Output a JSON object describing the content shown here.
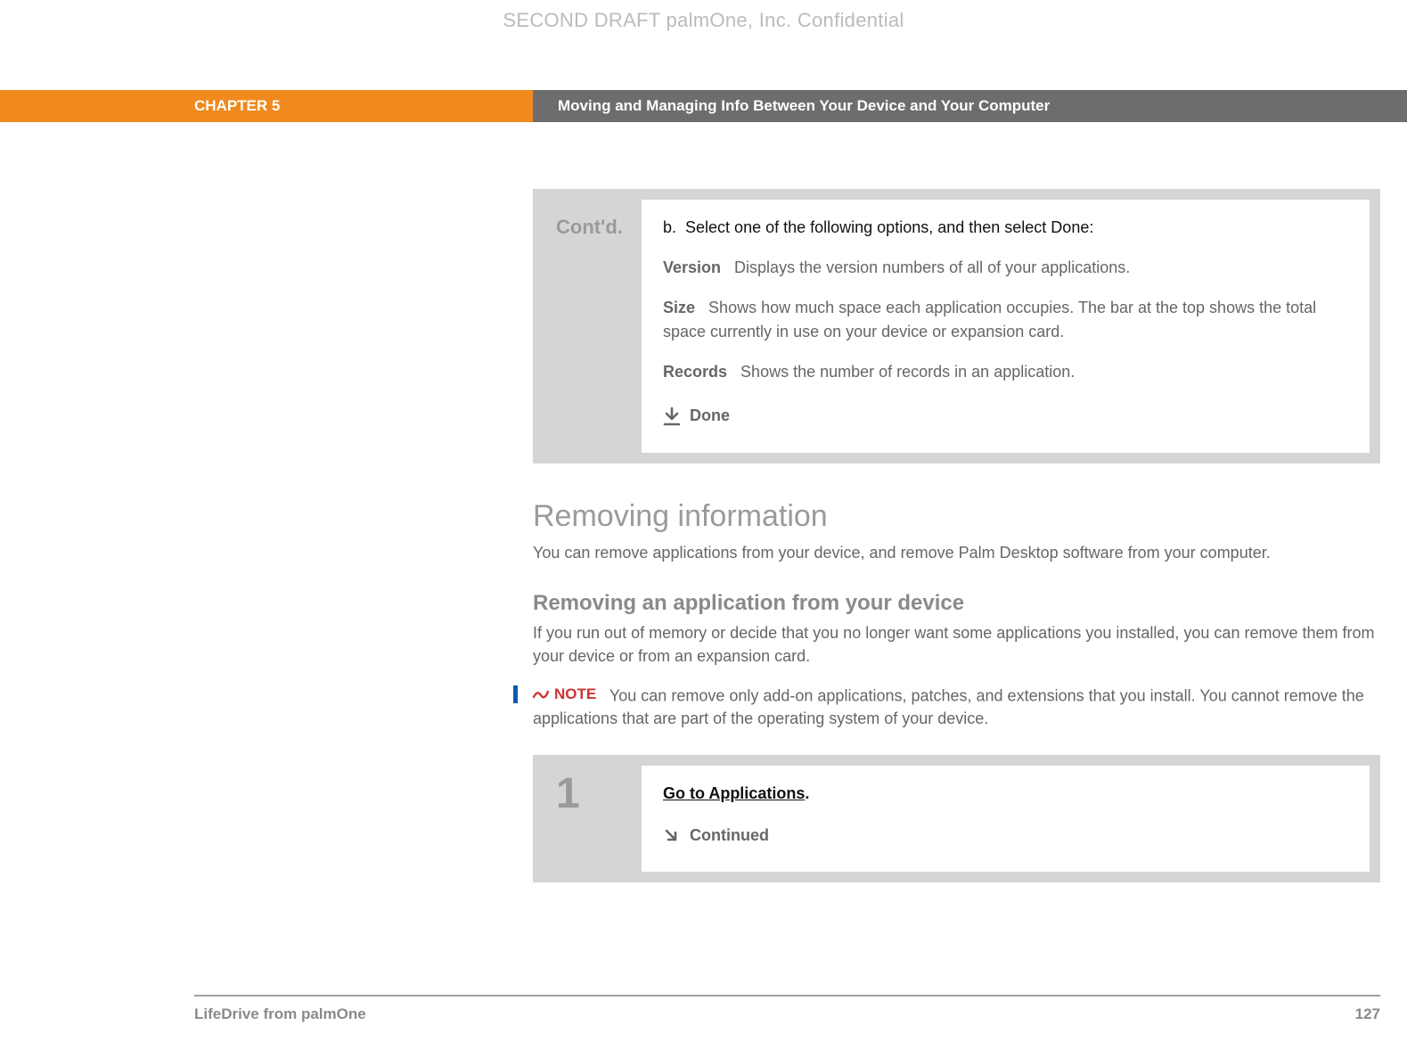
{
  "watermark": "SECOND DRAFT palmOne, Inc.  Confidential",
  "chapter": {
    "label": "CHAPTER 5",
    "title": "Moving and Managing Info Between Your Device and Your Computer"
  },
  "contd_box": {
    "label": "Cont'd.",
    "substep_letter": "b.",
    "substep_text": "Select one of the following options, and then select Done:",
    "defs": [
      {
        "term": "Version",
        "desc": "Displays the version numbers of all of your applications."
      },
      {
        "term": "Size",
        "desc": "Shows how much space each application occupies. The bar at the top shows the total space currently in use on your device or expansion card."
      },
      {
        "term": "Records",
        "desc": "Shows the number of records in an application."
      }
    ],
    "done": "Done"
  },
  "section": {
    "h1": "Removing information",
    "p1": "You can remove applications from your device, and remove Palm Desktop software from your computer.",
    "h2": "Removing an application from your device",
    "p2": "If you run out of memory or decide that you no longer want some applications you installed, you can remove them from your device or from an expansion card.",
    "note_label": "NOTE",
    "note_text": "You can remove only add-on applications, patches, and extensions that you install. You cannot remove the applications that are part of the operating system of your device."
  },
  "step1": {
    "num": "1",
    "link": "Go to Applications",
    "period": ".",
    "continued": "Continued"
  },
  "footer": {
    "left": "LifeDrive from palmOne",
    "right": "127"
  }
}
